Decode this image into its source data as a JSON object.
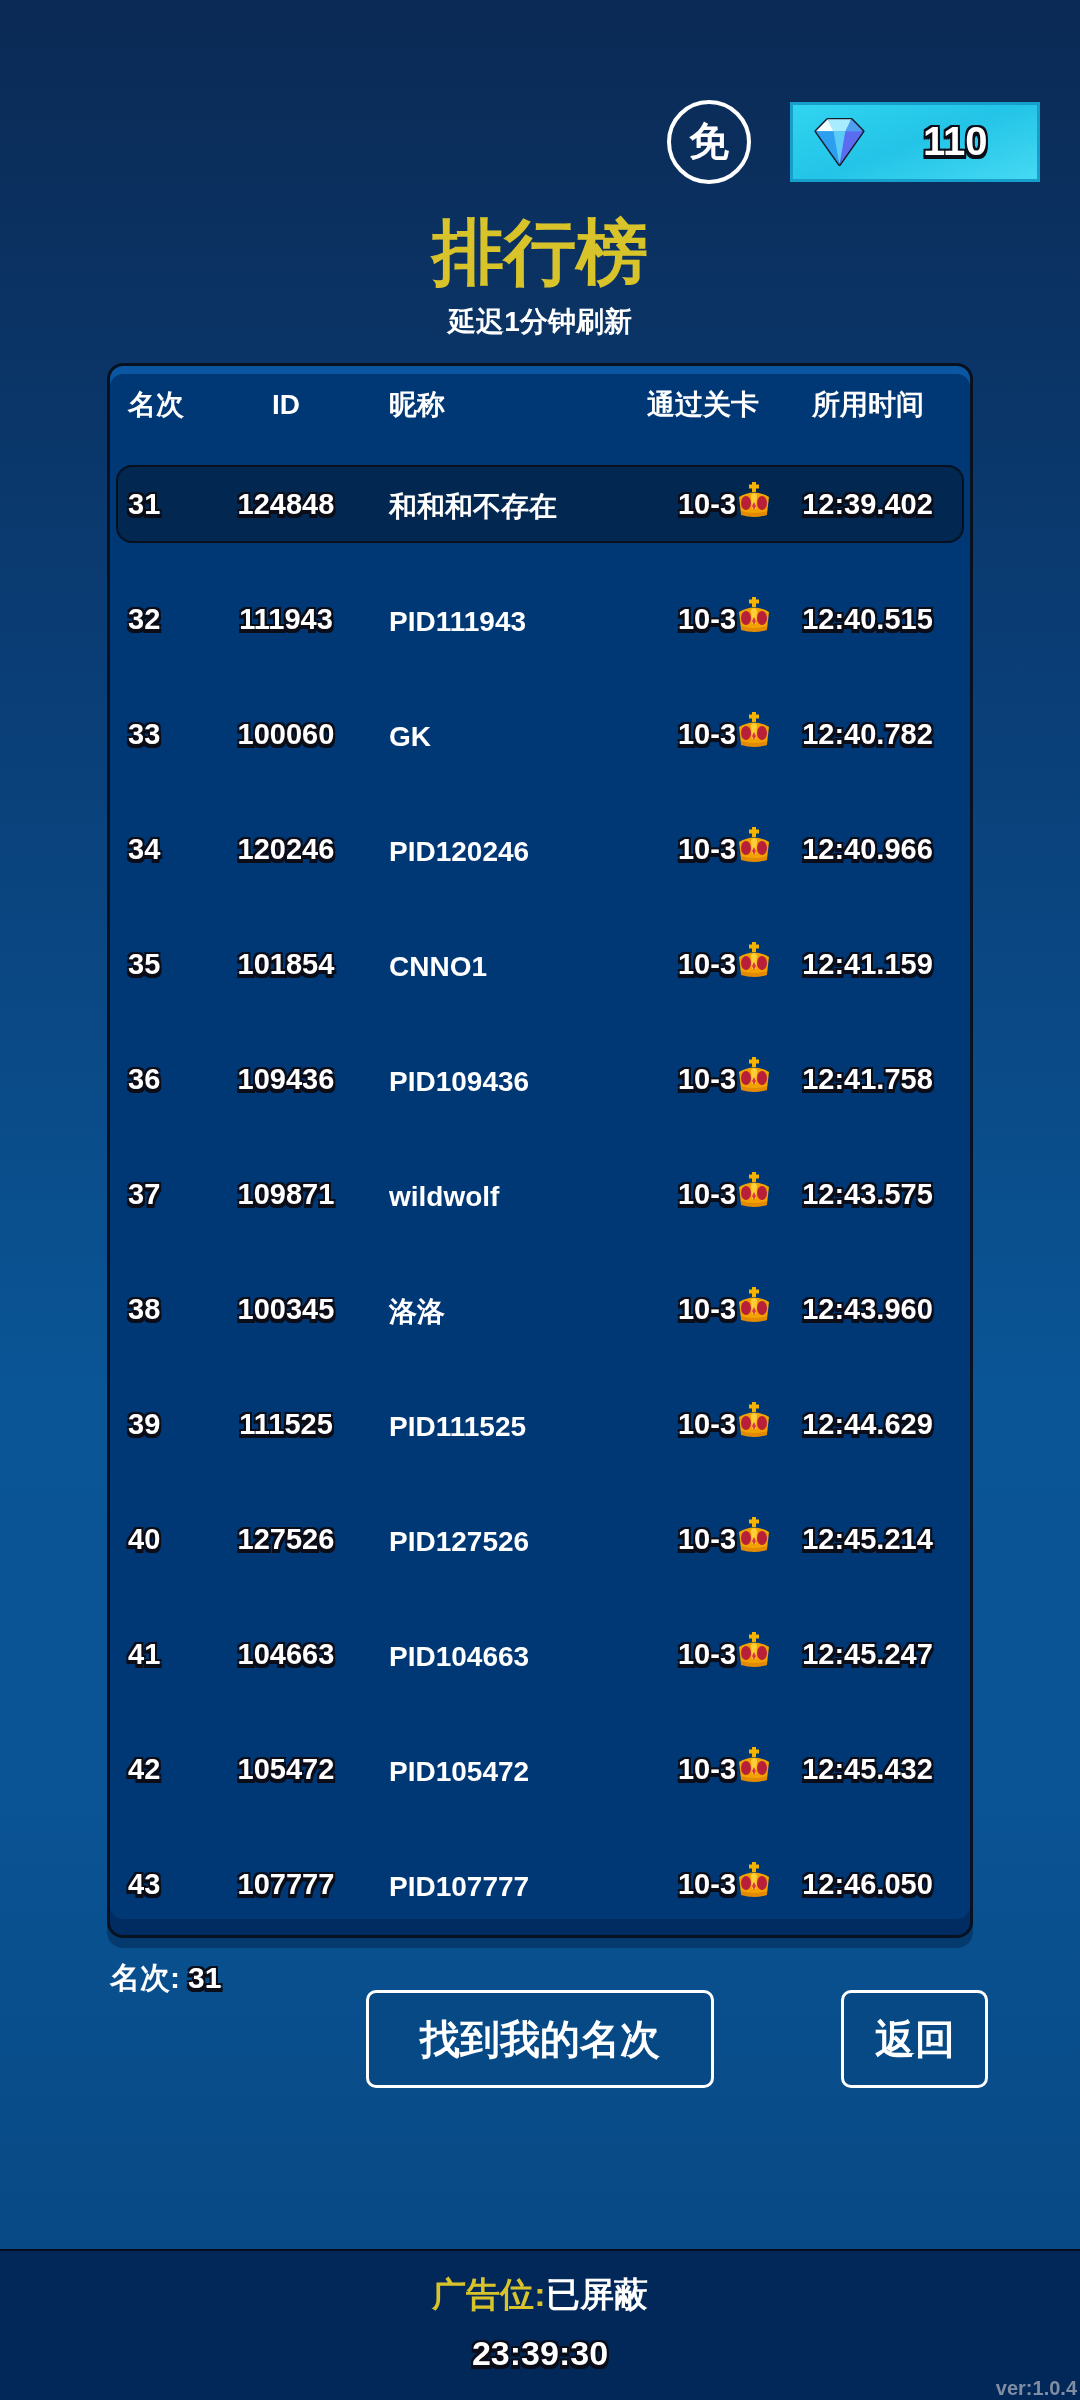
{
  "header": {
    "free_badge": "免",
    "gems": "110"
  },
  "title": "排行榜",
  "subtitle": "延迟1分钟刷新",
  "table": {
    "columns": [
      "名次",
      "ID",
      "昵称",
      "通过关卡",
      "所用时间"
    ],
    "rows": [
      {
        "rank": "31",
        "id": "124848",
        "nickname": "和和和不存在",
        "stage": "10-3",
        "time": "12:39.402",
        "highlighted": true
      },
      {
        "rank": "32",
        "id": "111943",
        "nickname": "PID111943",
        "stage": "10-3",
        "time": "12:40.515",
        "highlighted": false
      },
      {
        "rank": "33",
        "id": "100060",
        "nickname": "GK",
        "stage": "10-3",
        "time": "12:40.782",
        "highlighted": false
      },
      {
        "rank": "34",
        "id": "120246",
        "nickname": "PID120246",
        "stage": "10-3",
        "time": "12:40.966",
        "highlighted": false
      },
      {
        "rank": "35",
        "id": "101854",
        "nickname": "CNNO1",
        "stage": "10-3",
        "time": "12:41.159",
        "highlighted": false
      },
      {
        "rank": "36",
        "id": "109436",
        "nickname": "PID109436",
        "stage": "10-3",
        "time": "12:41.758",
        "highlighted": false
      },
      {
        "rank": "37",
        "id": "109871",
        "nickname": "wildwolf",
        "stage": "10-3",
        "time": "12:43.575",
        "highlighted": false
      },
      {
        "rank": "38",
        "id": "100345",
        "nickname": "洛洛",
        "stage": "10-3",
        "time": "12:43.960",
        "highlighted": false
      },
      {
        "rank": "39",
        "id": "111525",
        "nickname": "PID111525",
        "stage": "10-3",
        "time": "12:44.629",
        "highlighted": false
      },
      {
        "rank": "40",
        "id": "127526",
        "nickname": "PID127526",
        "stage": "10-3",
        "time": "12:45.214",
        "highlighted": false
      },
      {
        "rank": "41",
        "id": "104663",
        "nickname": "PID104663",
        "stage": "10-3",
        "time": "12:45.247",
        "highlighted": false
      },
      {
        "rank": "42",
        "id": "105472",
        "nickname": "PID105472",
        "stage": "10-3",
        "time": "12:45.432",
        "highlighted": false
      },
      {
        "rank": "43",
        "id": "107777",
        "nickname": "PID107777",
        "stage": "10-3",
        "time": "12:46.050",
        "highlighted": false
      }
    ]
  },
  "my_rank": {
    "label": "名次:",
    "value": "31"
  },
  "buttons": [
    "找到我的名次",
    "返回"
  ],
  "footer": {
    "ad_label": "广告位:",
    "ad_status": "已屏蔽",
    "clock": "23:39:30",
    "version": "ver:1.0.4"
  }
}
